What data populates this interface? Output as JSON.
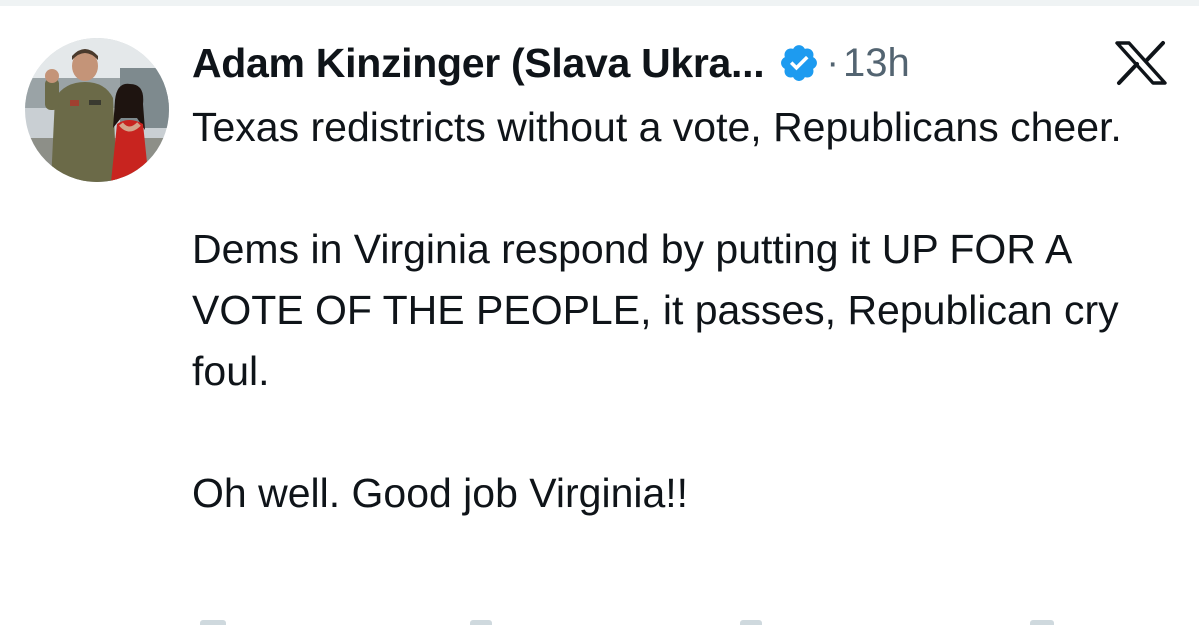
{
  "tweet": {
    "display_name": "Adam Kinzinger (Slava Ukra...",
    "separator": "·",
    "timestamp": "13h",
    "body_paragraphs": [
      "Texas redistricts without a vote, Republicans cheer.",
      "Dems in Virginia respond by putting it UP FOR A VOTE OF THE PEOPLE, it passes, Republican cry foul.",
      "Oh well.  Good job Virginia!!"
    ]
  },
  "icons": {
    "verified": "verified-badge-icon",
    "platform_logo": "x-logo-icon",
    "avatar": "avatar-photo"
  },
  "colors": {
    "text_primary": "#0f1419",
    "text_secondary": "#536471",
    "verified_blue": "#1d9bf0",
    "background": "#ffffff"
  }
}
